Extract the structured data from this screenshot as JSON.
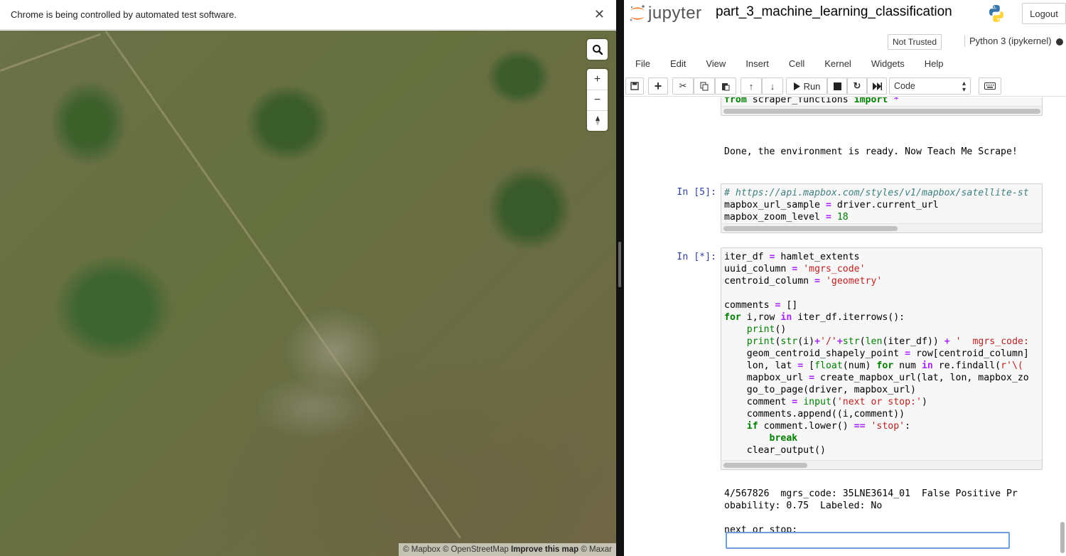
{
  "browser": {
    "infobar_text": "Chrome is being controlled by automated test software.",
    "close_icon": "close-icon"
  },
  "map": {
    "controls": {
      "search_icon": "search-icon",
      "zoom_in": "+",
      "zoom_out": "−",
      "compass": "compass-icon"
    },
    "attribution": {
      "mapbox": "© Mapbox",
      "osm": "© OpenStreetMap",
      "improve": "Improve this map",
      "maxar": "© Maxar"
    }
  },
  "jupyter": {
    "logo_text": "jupyter",
    "notebook_title": "part_3_machine_learning_classification",
    "logout_label": "Logout",
    "trusted_label": "Not Trusted",
    "kernel_name": "Python 3 (ipykernel)",
    "menu": [
      "File",
      "Edit",
      "View",
      "Insert",
      "Cell",
      "Kernel",
      "Widgets",
      "Help"
    ],
    "toolbar": {
      "run_label": "Run",
      "cell_type": "Code"
    },
    "cells": [
      {
        "prompt": "",
        "lines": [
          "from scraper_functions import *"
        ],
        "output": [
          "Done, the environment is ready. Now Teach Me Scrape!"
        ]
      },
      {
        "prompt": "In [5]:",
        "lines": [
          "# https://api.mapbox.com/styles/v1/mapbox/satellite-st",
          "mapbox_url_sample = driver.current_url",
          "mapbox_zoom_level = 18"
        ]
      },
      {
        "prompt": "In [*]:",
        "lines": [
          "iter_df = hamlet_extents",
          "uuid_column = 'mgrs_code'",
          "centroid_column = 'geometry'",
          "",
          "comments = []",
          "for i,row in iter_df.iterrows():",
          "    print()",
          "    print(str(i)+'/'+str(len(iter_df)) + '  mgrs_code:",
          "    geom_centroid_shapely_point = row[centroid_column]",
          "    lon, lat = [float(num) for num in re.findall(r'\\(",
          "    mapbox_url = create_mapbox_url(lat, lon, mapbox_zo",
          "    go_to_page(driver, mapbox_url)",
          "    comment = input('next or stop:')",
          "    comments.append((i,comment))",
          "    if comment.lower() == 'stop':",
          "        break",
          "    clear_output()"
        ],
        "output": [
          "4/567826  mgrs_code: 35LNE3614_01  False Positive Pr",
          "obability: 0.75  Labeled: No",
          "",
          "next or stop:"
        ],
        "stdin_value": ""
      }
    ]
  }
}
